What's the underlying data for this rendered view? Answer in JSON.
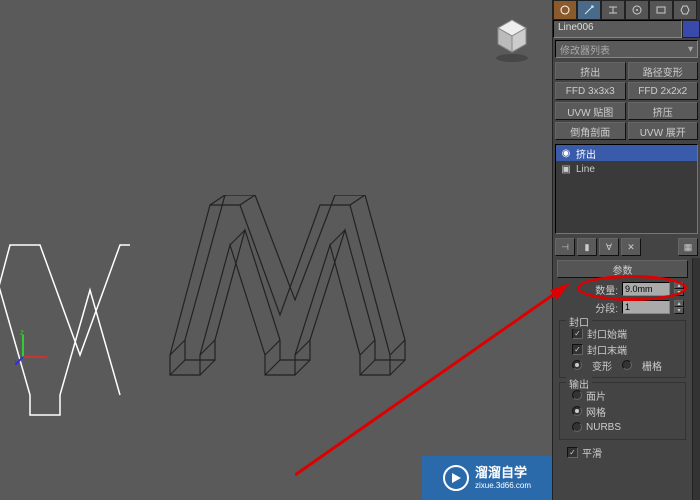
{
  "viewport": {
    "cube_label": ""
  },
  "object": {
    "name": "Line006"
  },
  "modifier_list": {
    "placeholder": "修改器列表"
  },
  "mod_buttons": {
    "extrude": "挤出",
    "path_deform": "路径变形",
    "ffd3": "FFD 3x3x3",
    "ffd2": "FFD 2x2x2",
    "uvw_map": "UVW 贴图",
    "squeeze": "挤压",
    "chamfer": "倒角剖面",
    "uvw_unwrap": "UVW 展开"
  },
  "stack": {
    "item_active": "挤出",
    "item_line": "Line"
  },
  "rollouts": {
    "params": "参数",
    "amount_label": "数量:",
    "amount_value": "9.0mm",
    "segments_label": "分段:",
    "segments_value": "1",
    "cap_group": "封口",
    "cap_start": "封口始端",
    "cap_end": "封口末端",
    "morph": "变形",
    "grid": "栅格",
    "output_group": "输出",
    "face": "面片",
    "mesh": "网格",
    "nurbs": "NURBS",
    "smooth": "平滑"
  },
  "watermark": {
    "title": "溜溜自学",
    "url": "zixue.3d66.com"
  }
}
